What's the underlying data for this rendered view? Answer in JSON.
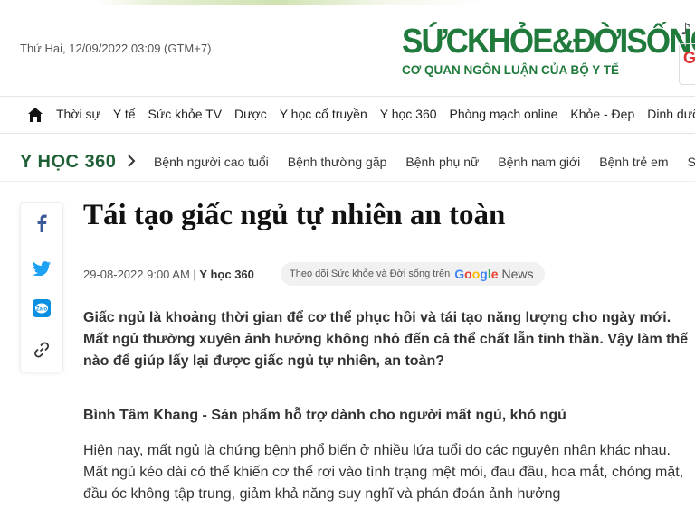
{
  "header": {
    "date": "Thứ Hai, 12/09/2022 03:09 (GTM+7)",
    "logo_main": "SỨCKHỎE&ĐỜISỐNG",
    "logo_sub": "CƠ QUAN NGÔN LUẬN CỦA BỘ Y TẾ",
    "side_badge": "G"
  },
  "nav": {
    "items": [
      "Thời sự",
      "Y tế",
      "Sức khỏe TV",
      "Dược",
      "Y học cổ truyền",
      "Y học 360",
      "Phòng mạch online",
      "Khỏe - Đẹp",
      "Dinh dưỡng"
    ]
  },
  "subnav": {
    "title": "Y HỌC 360",
    "items": [
      "Bệnh người cao tuổi",
      "Bệnh thường gặp",
      "Bệnh phụ nữ",
      "Bệnh nam giới",
      "Bệnh trẻ em",
      "Sức kh"
    ]
  },
  "article": {
    "title": "Tái tạo giấc ngủ tự nhiên an toàn",
    "datetime": "29-08-2022 9:00 AM",
    "separator": " | ",
    "category": "Y học 360",
    "follow_text": "Theo dõi Sức khỏe và Đời sống trên",
    "google_news": "News",
    "lead": "Giấc ngủ là khoảng thời gian để cơ thể phục hồi và tái tạo năng lượng cho ngày mới. Mất ngủ thường xuyên ảnh hưởng không nhỏ đến cả thể chất lẫn tinh thần. Vậy làm thế nào để giúp lấy lại được giấc ngủ tự nhiên, an toàn?",
    "subheading": "Bình Tâm Khang - Sản phẩm hỗ trợ dành cho người mất ngủ, khó ngủ",
    "body": "Hiện nay, mất ngủ là chứng bệnh phổ biến ở nhiều lứa tuổi do các nguyên nhân khác nhau. Mất ngủ kéo dài có thể khiến cơ thể rơi vào tình trạng mệt mỏi, đau đầu, hoa mắt, chóng mặt, đầu óc không tập trung, giảm khả năng suy nghĩ và phán đoán ảnh hưởng"
  },
  "share": [
    "facebook-icon",
    "twitter-icon",
    "zalo-icon",
    "link-icon"
  ],
  "colors": {
    "brand_green": "#1f7a3c",
    "facebook": "#3b5998",
    "twitter": "#1da1f2",
    "zalo": "#0a8fe3"
  }
}
